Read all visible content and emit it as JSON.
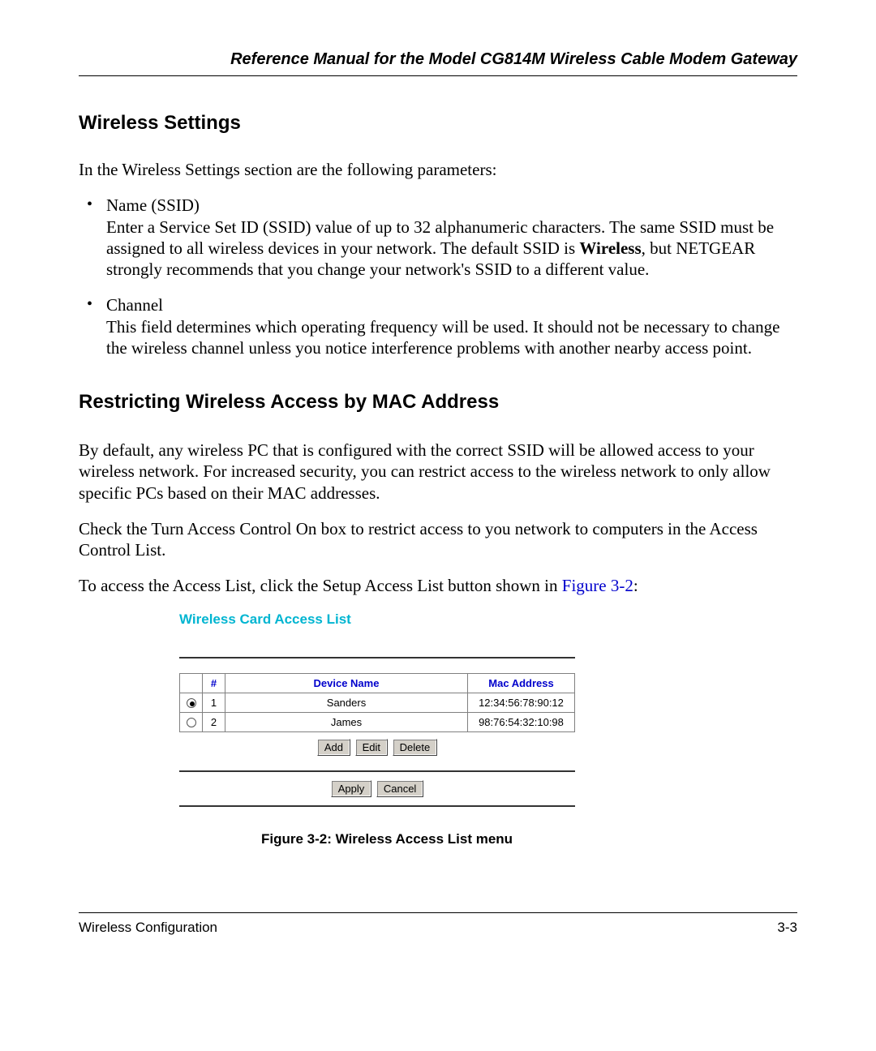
{
  "header": {
    "title": "Reference Manual for the Model CG814M Wireless Cable Modem Gateway"
  },
  "section1": {
    "heading": "Wireless Settings",
    "intro": "In the Wireless Settings section are the following parameters:",
    "items": [
      {
        "title": "Name (SSID)",
        "body_pre": "Enter a Service Set ID (SSID) value of up to 32 alphanumeric characters. The same SSID must be assigned to all wireless devices in your network. The default SSID is ",
        "body_bold": "Wireless",
        "body_post": ", but NETGEAR strongly recommends that you change your network's SSID to a different value."
      },
      {
        "title": "Channel",
        "body": "This field determines which operating frequency will be used. It should not be necessary to change the wireless channel unless you notice interference problems with another nearby access point."
      }
    ]
  },
  "section2": {
    "heading": "Restricting Wireless Access by MAC Address",
    "p1": "By default, any wireless PC that is configured with the correct SSID will be allowed access to your wireless network. For increased security, you can restrict access to the wireless network to only allow specific PCs based on their MAC addresses.",
    "p2": "Check the Turn Access Control On box to restrict access to you network to computers in the Access Control List.",
    "p3_pre": "To access the Access List, click the Setup Access List button shown in ",
    "p3_link": "Figure 3-2",
    "p3_post": ":"
  },
  "figure": {
    "title": "Wireless Card Access List",
    "headers": {
      "num": "#",
      "name": "Device Name",
      "mac": "Mac Address"
    },
    "rows": [
      {
        "selected": true,
        "num": "1",
        "name": "Sanders",
        "mac": "12:34:56:78:90:12"
      },
      {
        "selected": false,
        "num": "2",
        "name": "James",
        "mac": "98:76:54:32:10:98"
      }
    ],
    "buttons_row1": {
      "add": "Add",
      "edit": "Edit",
      "delete": "Delete"
    },
    "buttons_row2": {
      "apply": "Apply",
      "cancel": "Cancel"
    },
    "caption": "Figure 3-2:  Wireless Access List menu"
  },
  "footer": {
    "left": "Wireless Configuration",
    "right": "3-3"
  }
}
